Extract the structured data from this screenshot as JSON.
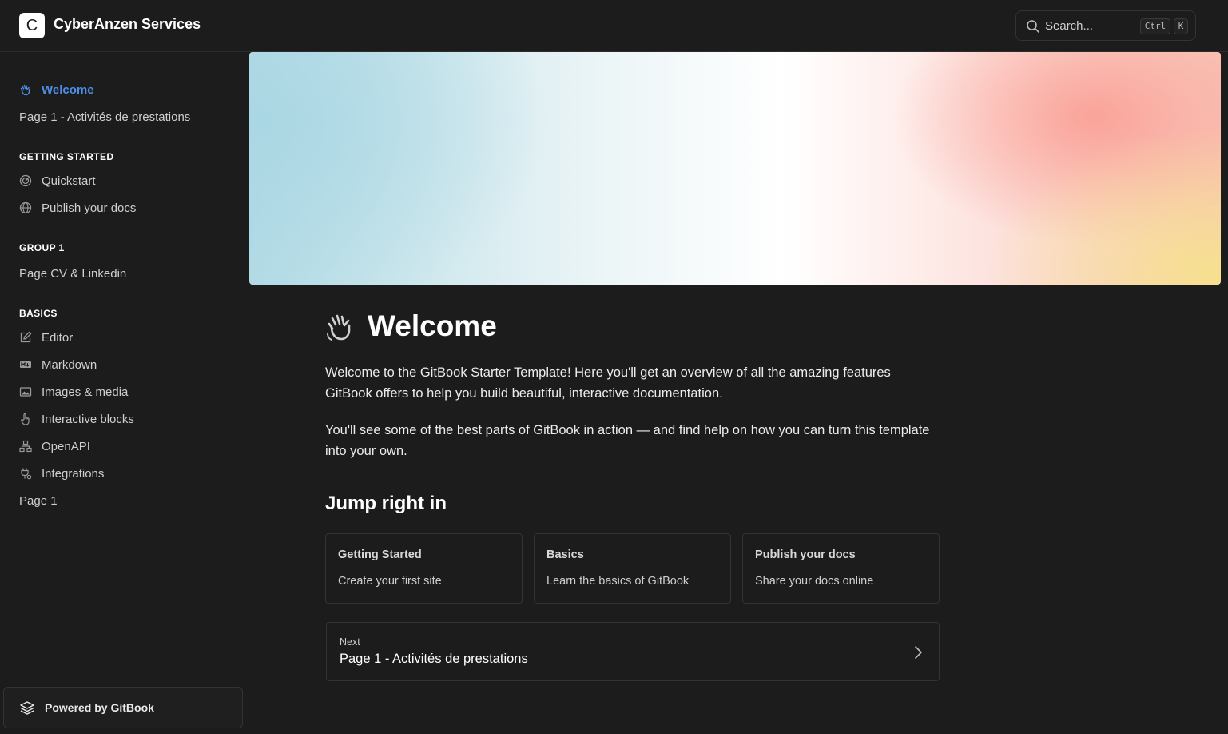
{
  "header": {
    "logo_letter": "C",
    "site_title": "CyberAnzen Services",
    "search_placeholder": "Search...",
    "shortcut_ctrl": "Ctrl",
    "shortcut_key": "K"
  },
  "sidebar": {
    "top_items": [
      {
        "label": "Welcome",
        "icon": "waving-hand-icon",
        "active": true
      },
      {
        "label": "Page 1 - Activités de prestations"
      }
    ],
    "sections": [
      {
        "title": "GETTING STARTED",
        "items": [
          {
            "label": "Quickstart",
            "icon": "target-icon"
          },
          {
            "label": "Publish your docs",
            "icon": "globe-icon"
          }
        ]
      },
      {
        "title": "GROUP 1",
        "items": [
          {
            "label": "Page CV & Linkedin"
          }
        ]
      },
      {
        "title": "BASICS",
        "items": [
          {
            "label": "Editor",
            "icon": "pen-to-square-icon"
          },
          {
            "label": "Markdown",
            "icon": "markdown-icon"
          },
          {
            "label": "Images & media",
            "icon": "image-icon"
          },
          {
            "label": "Interactive blocks",
            "icon": "hand-pointer-icon"
          },
          {
            "label": "OpenAPI",
            "icon": "sitemap-icon"
          },
          {
            "label": "Integrations",
            "icon": "plug-icon"
          },
          {
            "label": "Page 1"
          }
        ]
      }
    ],
    "powered_by": "Powered by GitBook"
  },
  "main": {
    "title": "Welcome",
    "paragraphs": [
      "Welcome to the GitBook Starter Template! Here you'll get an overview of all the amazing features GitBook offers to help you build beautiful, interactive documentation.",
      "You'll see some of the best parts of GitBook in action — and find help on how you can turn this template into your own."
    ],
    "section_heading": "Jump right in",
    "cards": [
      {
        "title": "Getting Started",
        "description": "Create your first site"
      },
      {
        "title": "Basics",
        "description": "Learn the basics of GitBook"
      },
      {
        "title": "Publish your docs",
        "description": "Share your docs online"
      }
    ],
    "next": {
      "label": "Next",
      "title": "Page 1 - Activités de prestations"
    }
  },
  "colors": {
    "background": "#1c1c1c",
    "accent": "#4d8fe8",
    "border": "#333333"
  }
}
